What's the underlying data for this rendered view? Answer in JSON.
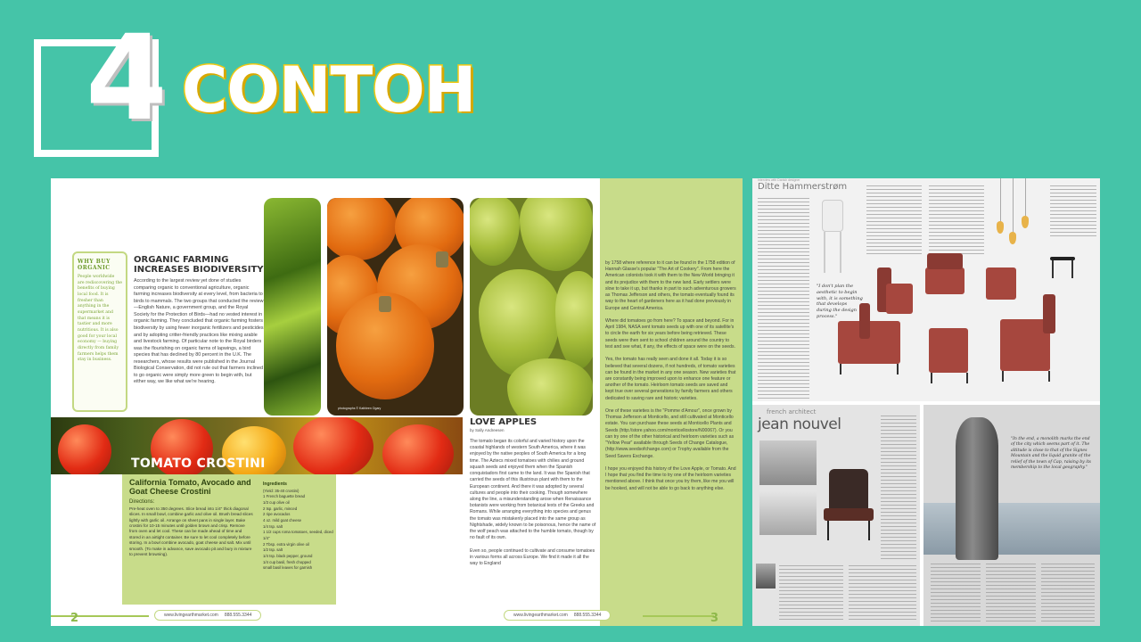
{
  "title": {
    "number": "4",
    "text": "CONTOH"
  },
  "colors": {
    "background": "#45c4a8",
    "title_outline": "#f2c811",
    "green_accent": "#c8dc8a"
  },
  "magazine": {
    "why_buy": {
      "title": "WHY BUY ORGANIC",
      "text": "People worldwide are rediscovering the benefits of buying local food. It is fresher than anything in the supermarket and that means it is tastier and more nutritious. It is also good for your local economy — buying directly from family farmers helps them stay in business."
    },
    "organic": {
      "title": "ORGANIC FARMING INCREASES BIODIVERSITY",
      "body": "According to the largest review yet done of studies comparing organic to conventional agriculture, organic farming increases biodiversity at every level, from bacteria to birds to mammals. The two groups that conducted the review—English Nature, a government group, and the Royal Society for the Protection of Birds—had no vested interest in organic farming. They concluded that organic farming fosters biodiversity by using fewer inorganic fertilizers and pesticides and by adopting critter-friendly practices like mixing arable and livestock farming. Of particular note to the Royal birders was the flourishing on organic farms of lapwings, a bird species that has declined by 80 percent in the U.K. The researchers, whose results were published in the Journal Biological Conservation, did not rule out that farmers inclined to go organic were simply more green to begin with, but either way, we like what we're hearing."
    },
    "photo_credit": "photographs © Kathleen Ogary",
    "tomato_crostini": {
      "banner": "TOMATO CROSTINI",
      "title": "California Tomato, Avocado and Goat Cheese Crostini",
      "directions_label": "Directions:",
      "directions": "Pre-heat oven to 350 degrees. Slice bread into 1/4\" thick diagonal slices. In small bowl, combine garlic and olive oil. Brush bread slices lightly with garlic oil. Arrange on sheet pans in single layer. Bake crostini for 10-15 minutes until golden brown and crisp. Remove from oven and let cool. These can be made ahead of time and stored in an airtight container. Be sure to let cool completely before storing. In a bowl combine avocado, goat cheese and salt. Mix until smooth. (To make in advance, save avocado pit and bury in mixture to prevent browning).",
      "ingredients_label": "Ingredients",
      "ingredients": [
        "(Yield: 35-40 crostini)",
        "1 French baguette bread",
        "1/3 cup olive oil",
        "2 tsp. garlic, minced",
        "2 ripe avocados",
        "4 oz. mild goat cheese",
        "1/4 tsp. salt",
        "1 1/2 cups roma tomatoes, seeded, diced 1/4\"",
        "2 Tbsp. extra virgin olive oil",
        "1/2 tsp. salt",
        "1/4 tsp. black pepper, ground",
        "1/4 cup basil, fresh chopped",
        "small basil leaves for garnish"
      ]
    },
    "love_apples": {
      "title": "LOVE APPLES",
      "byline": "by Sally Andreesen",
      "body": "The tomato began its colorful and varied history upon the coastal highlands of western South America, where it was enjoyed by the native peoples of South America for a long time. The Aztecs mixed tomatoes with chilies and ground squash seeds and enjoyed them when the Spanish conquistadors first came to the land. It was the Spanish that carried the seeds of this illustrious plant with them to the European continent. And there it was adopted by several cultures and people into their cooking. Though somewhere along the line, a misunderstanding arose when Renaissance botanists were working from botanical texts of the Greeks and Romans. While arranging everything into species and genus the tomato was mistakenly placed into the same group as Nightshade, widely known to be poisonous, hence the name of the wolf peach was attached to the humble tomato, though by no fault of its own.\n\nEven so, people continued to cultivate and consume tomatoes in various forms all across Europe. We find it made it all the way to England"
    },
    "right_column": "by 1758 where reference to it can be found in the 1758 edition of Hannah Glasse's popular \"The Art of Cookery\". From here the American colonists took it with them to the New World bringing it and its prejudice with them to the new land. Early settlers were slow to take it up, but thanks in part to such adventurous growers as Thomas Jefferson and others, the tomato eventually found its way to the heart of gardeners here as it had done previously in Europe and Central America.\n\nWhere did tomatoes go from here? To space and beyond. For in April 1984, NASA sent tomato seeds up with one of its satellite's to circle the earth for six years before being retrieved. These seeds were then sent to school children around the country to test and see what, if any, the effects of space were on the seeds.\n\nYes, the tomato has really seen and done it all. Today it is so believed that several dozens, if not hundreds, of tomato varieties can be found in the market in any one season. New varieties that are constantly being improved upon to enhance one feature or another of the tomato. Heirloom tomato seeds are saved and kept true over several generations by family farmers and others dedicated to saving rare and historic varieties.\n\nOne of these varieties is the \"Pomme d'Amour\", once grown by Thomas Jefferson at Monticello, and still cultivated at Monticello estate. You can purchase these seeds at Monticello Plants and Seeds (http://store.yahoo.com/monticellostore/N00067). Or you can try one of the other historical and heirloom varieties such as \"Yellow Pear\" available through Seeds of Change Catalogue, (http://www.seedsofchange.com) or Trophy available from the Seed Savers Exchange.\n\nI hope you enjoyed this history of the Love Apple, or Tomato. And I hope that you find the time to try one of the heirloom varieties mentioned above. I think that once you try them, like me you will be hooked, and will not be able to go back to anything else.",
    "footer_left": {
      "url": "www.livingearthmarket.com",
      "phone": "888.555.3344",
      "page": "2"
    },
    "footer_right": {
      "url": "www.livingearthmarket.com",
      "phone": "888.555.3344",
      "page": "3"
    }
  },
  "collage": {
    "top": {
      "subtitle": "Interview with Danish designer",
      "name": "Ditte Hammerstrøm",
      "quote": "\"I don't plan the aesthetic to begin with, it is something that develops during the design process.\""
    },
    "bottom": {
      "small": "french architect",
      "name": "jean nouvel",
      "quote": "\"In the end, a monolith marks the end of the city which seems part of it. The altitude is close to that of the Signes Mountain and the liquid granite of the relief of the town of Cap, raising by its membership to the local geography.\""
    }
  }
}
